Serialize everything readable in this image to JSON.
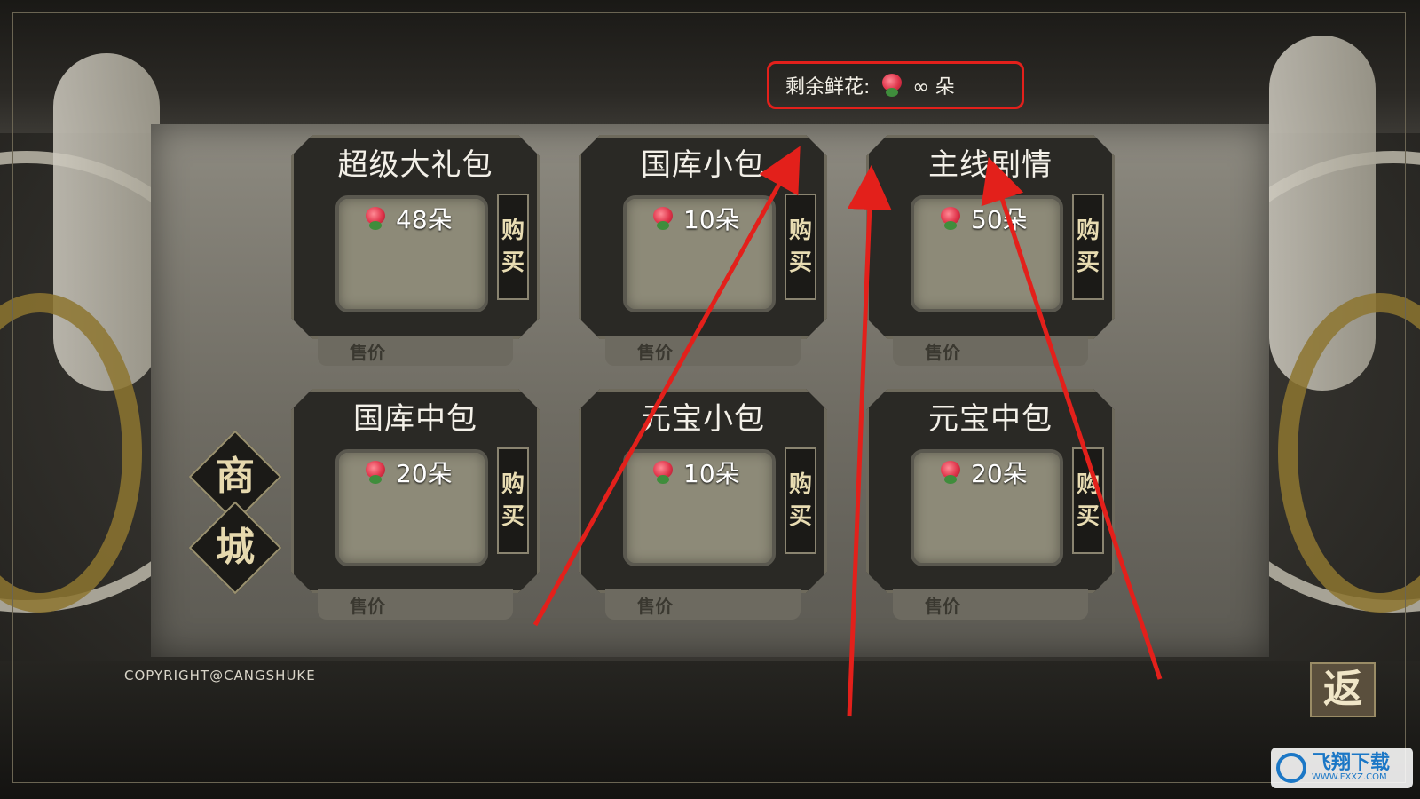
{
  "header": {
    "flower_label": "剩余鲜花:",
    "flower_amount": "∞ 朵"
  },
  "packs": [
    {
      "title": "超级大礼包",
      "price": "48朵",
      "buy_top": "购",
      "buy_bottom": "买",
      "sale_label": "售价"
    },
    {
      "title": "国库小包",
      "price": "10朵",
      "buy_top": "购",
      "buy_bottom": "买",
      "sale_label": "售价"
    },
    {
      "title": "主线剧情",
      "price": "50朵",
      "buy_top": "购",
      "buy_bottom": "买",
      "sale_label": "售价"
    },
    {
      "title": "国库中包",
      "price": "20朵",
      "buy_top": "购",
      "buy_bottom": "买",
      "sale_label": "售价"
    },
    {
      "title": "元宝小包",
      "price": "10朵",
      "buy_top": "购",
      "buy_bottom": "买",
      "sale_label": "售价"
    },
    {
      "title": "元宝中包",
      "price": "20朵",
      "buy_top": "购",
      "buy_bottom": "买",
      "sale_label": "售价"
    }
  ],
  "shop": {
    "char1": "商",
    "char2": "城"
  },
  "footer": {
    "copyright": "COPYRIGHT@CANGSHUKE",
    "back_label": "返"
  },
  "watermark": {
    "name": "飞翔下载",
    "url": "WWW.FXXZ.COM"
  },
  "icons": {
    "flower": "rose-icon",
    "app": "watermark-logo-icon"
  },
  "colors": {
    "highlight": "#e3201b",
    "annotation_arrow": "#e3201b"
  }
}
